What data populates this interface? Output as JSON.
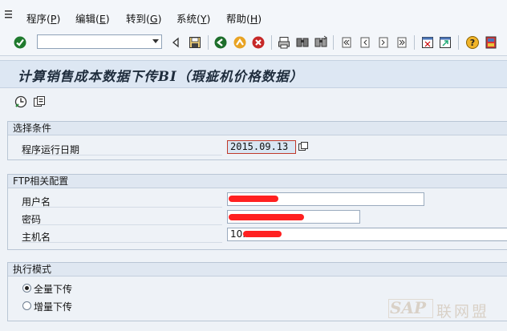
{
  "menu": {
    "items": [
      {
        "label": "程序(",
        "acc": "P",
        "tail": ")"
      },
      {
        "label": "编辑(",
        "acc": "E",
        "tail": ")"
      },
      {
        "label": "转到(",
        "acc": "G",
        "tail": ")"
      },
      {
        "label": "系统(",
        "acc": "Y",
        "tail": ")"
      },
      {
        "label": "帮助(",
        "acc": "H",
        "tail": ")"
      }
    ]
  },
  "toolbar": {
    "command_field_value": "",
    "icons": [
      "enter-icon",
      "back-arrow-icon",
      "save-icon",
      "back-icon",
      "exit-icon",
      "cancel-icon",
      "print-icon",
      "find-icon",
      "find-next-icon",
      "first-page-icon",
      "previous-page-icon",
      "next-page-icon",
      "last-page-icon",
      "new-session-icon",
      "shortcut-icon",
      "help-icon",
      "customize-layout-icon"
    ]
  },
  "title": "计算销售成本数据下传BI（瑕疵机价格数据）",
  "app_toolbar": {
    "icons": [
      "execute-icon",
      "variant-icon"
    ]
  },
  "groups": {
    "selection": {
      "header": "选择条件",
      "run_date_label": "程序运行日期",
      "run_date_value": "2015.09.13"
    },
    "ftp": {
      "header": "FTP相关配置",
      "username_label": "用户名",
      "username_value": "",
      "password_label": "密码",
      "password_value": "",
      "host_label": "主机名",
      "host_value_prefix": "10."
    },
    "mode": {
      "header": "执行模式",
      "options": [
        {
          "label": "全量下传",
          "selected": true
        },
        {
          "label": "增量下传",
          "selected": false
        }
      ]
    }
  },
  "watermark": {
    "brand": "SAP",
    "suffix": "联网盟"
  },
  "colors": {
    "title_bg": "#dde7f3",
    "group_header_bg": "#dfe7f1",
    "redaction": "#ff2020",
    "focus_border": "#c0392b"
  }
}
